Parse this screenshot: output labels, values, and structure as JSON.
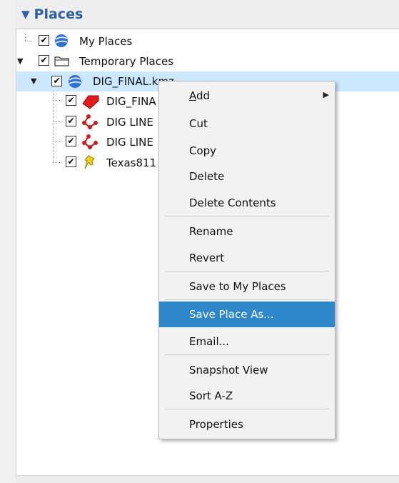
{
  "panel": {
    "toggle_glyph": "▼",
    "title": "Places"
  },
  "tree": {
    "my_places": {
      "label": "My Places",
      "checked": "✔",
      "icon": "earth-icon"
    },
    "temporary_places": {
      "label": "Temporary Places",
      "checked": "✔",
      "icon": "folder-icon",
      "expander": "▼"
    },
    "dig_final": {
      "label": "DIG_FINAL.kmz",
      "checked": "✔",
      "icon": "earth-icon",
      "expander": "▼",
      "selected": true
    },
    "children": [
      {
        "label": "DIG_FINA",
        "checked": "✔",
        "icon": "polygon-icon"
      },
      {
        "label": "DIG LINE",
        "checked": "✔",
        "icon": "line-icon"
      },
      {
        "label": "DIG LINE",
        "checked": "✔",
        "icon": "line-icon"
      },
      {
        "label": "Texas811",
        "checked": "✔",
        "icon": "pushpin-icon"
      }
    ]
  },
  "context_menu": {
    "add": {
      "label": "Add",
      "accel": "A",
      "rest": "dd",
      "submenu_arrow": "▶"
    },
    "cut": "Cut",
    "copy": "Copy",
    "delete": "Delete",
    "delete_contents": "Delete Contents",
    "rename": "Rename",
    "revert": "Revert",
    "save_to_my_places": "Save to My Places",
    "save_place_as": "Save Place As...",
    "email": "Email...",
    "snapshot_view": "Snapshot View",
    "sort_az": "Sort A-Z",
    "properties": "Properties",
    "highlighted_item": "save_place_as"
  },
  "colors": {
    "header_text": "#2f5fa7",
    "selection_bg": "#cce8ff",
    "menu_highlight": "#2d87c8"
  }
}
